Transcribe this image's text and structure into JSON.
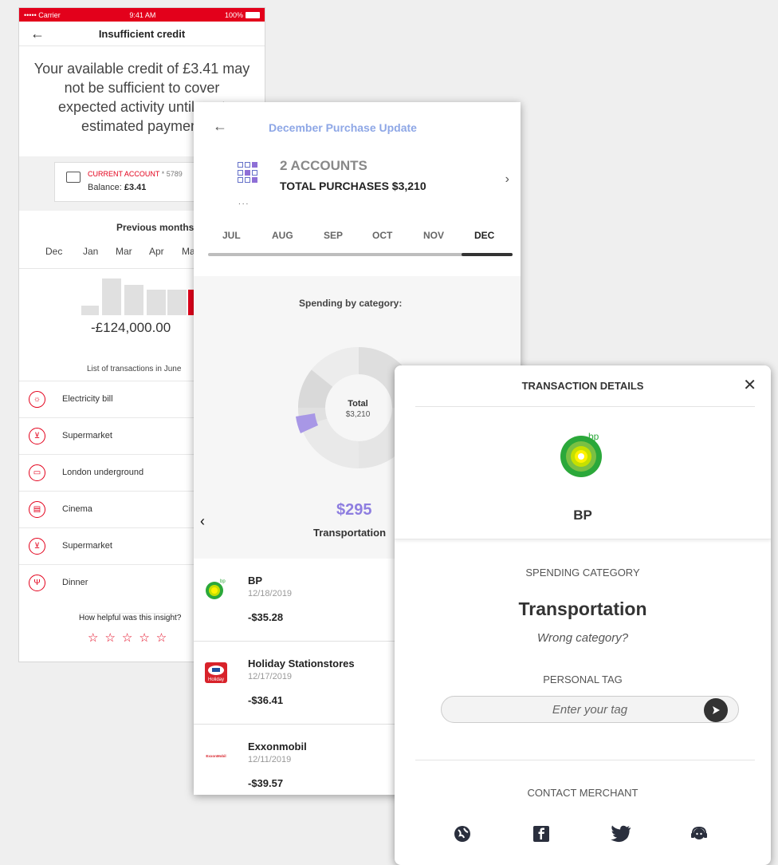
{
  "screen1": {
    "status": {
      "carrier": "••••• Carrier",
      "time": "9:41 AM",
      "battery": "100%"
    },
    "nav_title": "Insufficient credit",
    "message": "Your available credit of £3.41 may not be sufficient to cover expected activity until next estimated payment",
    "account": {
      "name": "CURRENT ACCOUNT",
      "number": " * 5789",
      "balance_label": "Balance: ",
      "balance": "£3.41"
    },
    "prev_title": "Previous months spending",
    "months": [
      "Dec",
      "Jan",
      "Mar",
      "Apr",
      "May"
    ],
    "amount": "-£124,000.00",
    "list_title": "List of transactions in June",
    "transactions": [
      "Electricity bill",
      "Supermarket",
      "London underground",
      "Cinema",
      "Supermarket",
      "Dinner"
    ],
    "helpful": "How helpful was this insight?",
    "stars": "☆☆☆☆☆",
    "bar_colors": {
      "neutral": "#e0e0e0",
      "accent": "#e3001b"
    }
  },
  "screen2": {
    "title": "December Purchase Update",
    "accounts": "2 ACCOUNTS",
    "total_label": "TOTAL PURCHASES ",
    "total_value": "$3,210",
    "dots": "...",
    "tabs": [
      "JUL",
      "AUG",
      "SEP",
      "OCT",
      "NOV",
      "DEC"
    ],
    "active_tab": "DEC",
    "spending_title": "Spending by category:",
    "donut_total_label": "Total",
    "donut_total_value": "$3,210",
    "highlight_amount": "$295",
    "highlight_category": "Transportation",
    "merchants": [
      {
        "name": "BP",
        "date": "12/18/2019",
        "amount": "-$35.28"
      },
      {
        "name": "Holiday Stationstores",
        "date": "12/17/2019",
        "amount": "-$36.41"
      },
      {
        "name": "Exxonmobil",
        "date": "12/11/2019",
        "amount": "-$39.57"
      }
    ],
    "logo_texts": {
      "bp": "bp",
      "holiday": "Holiday",
      "exxon": "ExxonMobil"
    },
    "accent_color": "#8e7ee0",
    "title_color": "#8ea7e6"
  },
  "screen3": {
    "title": "TRANSACTION DETAILS",
    "close": "✕",
    "logo_text": "bp",
    "merchant": "BP",
    "spending_label": "SPENDING CATEGORY",
    "category": "Transportation",
    "wrong": "Wrong category?",
    "tag_label": "PERSONAL TAG",
    "tag_placeholder": "Enter your tag",
    "contact_label": "CONTACT MERCHANT",
    "social_icons": [
      "globe-icon",
      "facebook-icon",
      "twitter-icon",
      "support-agent-icon"
    ]
  }
}
